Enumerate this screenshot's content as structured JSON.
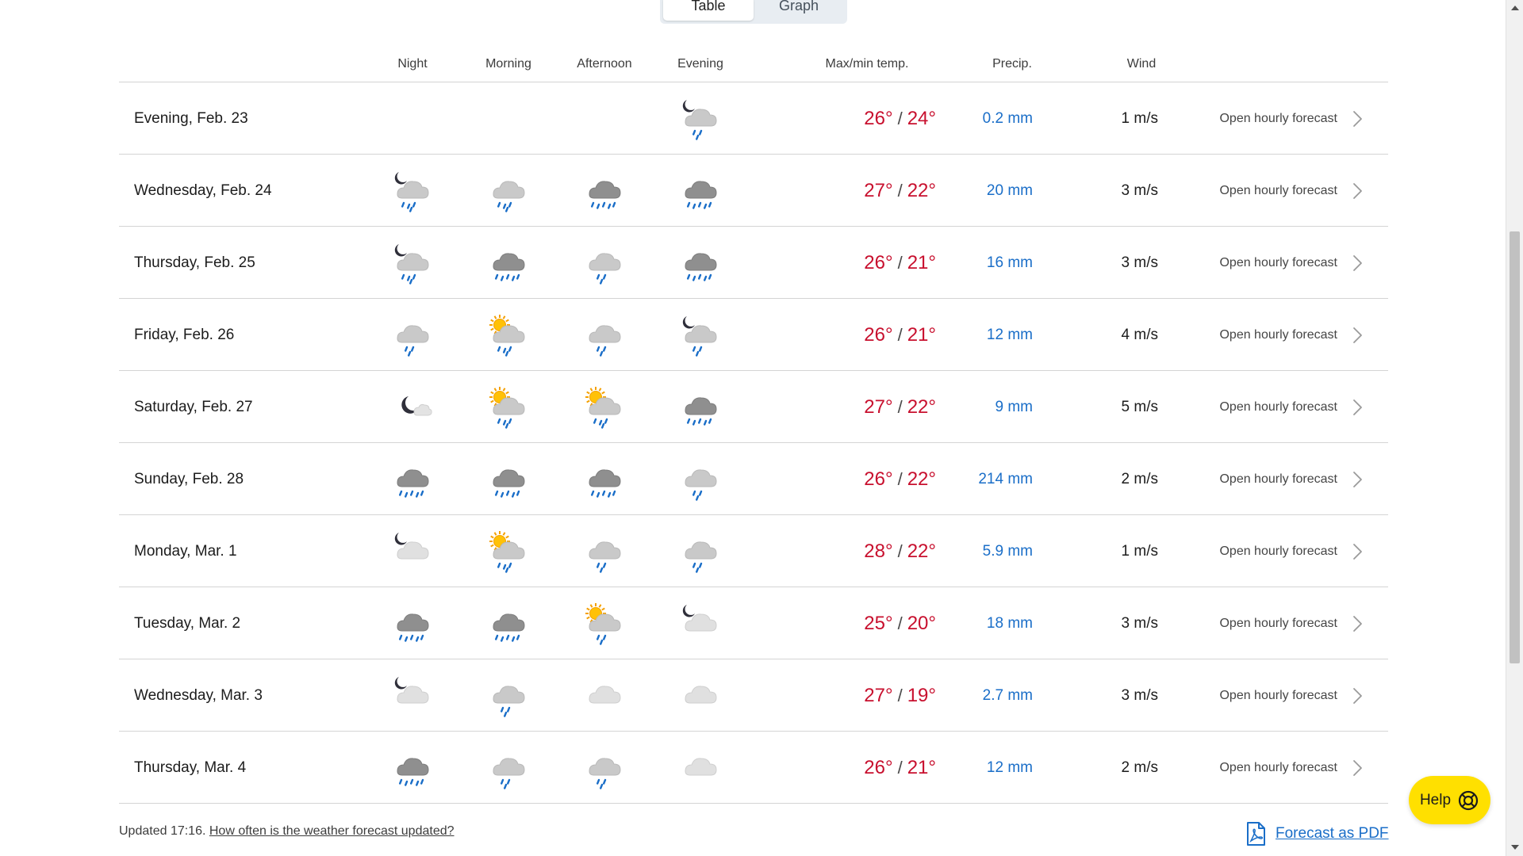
{
  "view_toggle": {
    "table_label": "Table",
    "graph_label": "Graph",
    "active": "Table"
  },
  "headers": {
    "night": "Night",
    "morning": "Morning",
    "afternoon": "Afternoon",
    "evening": "Evening",
    "temp": "Max/min temp.",
    "precip": "Precip.",
    "wind": "Wind"
  },
  "colors": {
    "temp": "#c8102e",
    "precip": "#1a6ec8",
    "help_bg": "#ffe000",
    "link": "#1a6ec8"
  },
  "rows": [
    {
      "date": "Evening, Feb. 23",
      "icons": [
        null,
        null,
        null,
        "night-cloud-light-rain"
      ],
      "max": "26°",
      "min": "24°",
      "precip": "0.2 mm",
      "wind": "1 m/s",
      "link": "Open hourly forecast"
    },
    {
      "date": "Wednesday, Feb. 24",
      "icons": [
        "night-cloud-rain",
        "cloud-rain",
        "cloud-heavy-rain",
        "cloud-heavy-rain"
      ],
      "max": "27°",
      "min": "22°",
      "precip": "20 mm",
      "wind": "3 m/s",
      "link": "Open hourly forecast"
    },
    {
      "date": "Thursday, Feb. 25",
      "icons": [
        "night-cloud-rain",
        "cloud-heavy-rain",
        "cloud-light-rain",
        "cloud-heavy-rain"
      ],
      "max": "26°",
      "min": "21°",
      "precip": "16 mm",
      "wind": "3 m/s",
      "link": "Open hourly forecast"
    },
    {
      "date": "Friday, Feb. 26",
      "icons": [
        "cloud-light-rain",
        "sun-cloud-rain",
        "cloud-light-rain",
        "night-cloud-light-rain"
      ],
      "max": "26°",
      "min": "21°",
      "precip": "12 mm",
      "wind": "4 m/s",
      "link": "Open hourly forecast"
    },
    {
      "date": "Saturday, Feb. 27",
      "icons": [
        "moon-cloud",
        "sun-cloud-rain",
        "sun-cloud-rain",
        "cloud-heavy-rain"
      ],
      "max": "27°",
      "min": "22°",
      "precip": "9 mm",
      "wind": "5 m/s",
      "link": "Open hourly forecast"
    },
    {
      "date": "Sunday, Feb. 28",
      "icons": [
        "cloud-heavy-rain",
        "cloud-heavy-rain",
        "cloud-heavy-rain",
        "cloud-light-rain"
      ],
      "max": "26°",
      "min": "22°",
      "precip": "214 mm",
      "wind": "2 m/s",
      "link": "Open hourly forecast"
    },
    {
      "date": "Monday, Mar. 1",
      "icons": [
        "night-cloud",
        "sun-cloud-rain",
        "cloud-light-rain",
        "cloud-light-rain"
      ],
      "max": "28°",
      "min": "22°",
      "precip": "5.9 mm",
      "wind": "1 m/s",
      "link": "Open hourly forecast"
    },
    {
      "date": "Tuesday, Mar. 2",
      "icons": [
        "cloud-heavy-rain",
        "cloud-heavy-rain",
        "sun-cloud-light-rain",
        "night-cloud"
      ],
      "max": "25°",
      "min": "20°",
      "precip": "18 mm",
      "wind": "3 m/s",
      "link": "Open hourly forecast"
    },
    {
      "date": "Wednesday, Mar. 3",
      "icons": [
        "night-cloud",
        "cloud-light-rain",
        "cloud",
        "cloud"
      ],
      "max": "27°",
      "min": "19°",
      "precip": "2.7 mm",
      "wind": "3 m/s",
      "link": "Open hourly forecast"
    },
    {
      "date": "Thursday, Mar. 4",
      "icons": [
        "cloud-heavy-rain",
        "cloud-light-rain",
        "cloud-light-rain",
        "cloud"
      ],
      "max": "26°",
      "min": "21°",
      "precip": "12 mm",
      "wind": "2 m/s",
      "link": "Open hourly forecast"
    }
  ],
  "footer": {
    "updated": "Updated 17:16.",
    "faq_link": "How often is the weather forecast updated?",
    "pdf_link": "Forecast as PDF",
    "pdf_icon": "pdf-icon",
    "help_label": "Help",
    "help_icon": "lifebuoy-icon"
  }
}
